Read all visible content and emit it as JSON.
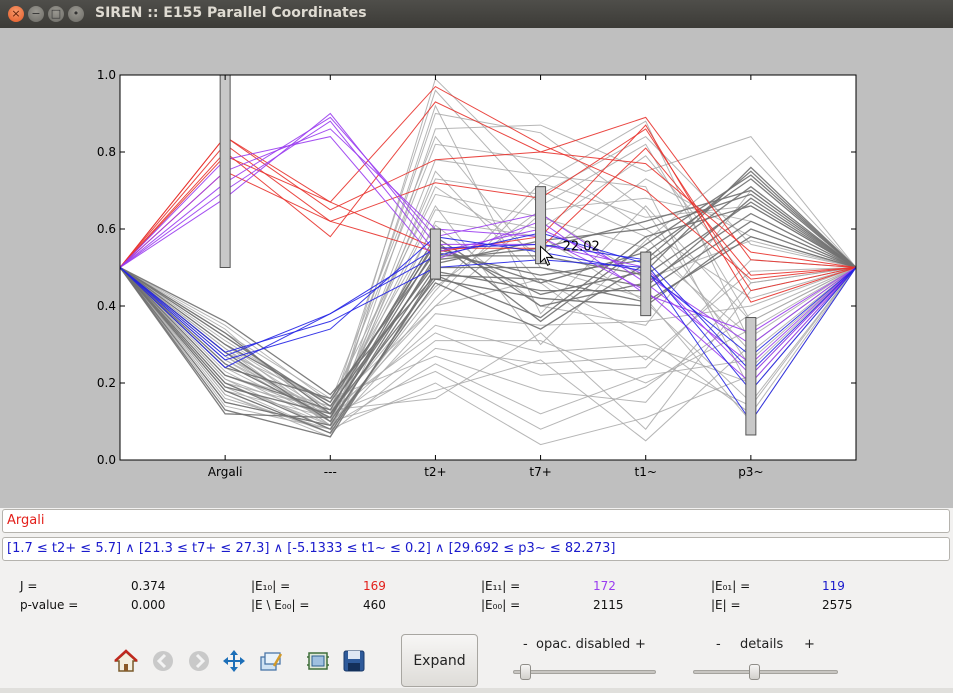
{
  "window": {
    "title": "SIREN :: E155 Parallel Coordinates",
    "close_glyph": "×",
    "min_glyph": "−",
    "max_glyph": "□",
    "extra_glyph": "•"
  },
  "chart_data": {
    "type": "line",
    "title": "",
    "xlabel": "",
    "ylabel": "",
    "ylim": [
      0,
      1.0
    ],
    "yticks": [
      "0.0",
      "0.2",
      "0.4",
      "0.6",
      "0.8",
      "1.0"
    ],
    "categories": [
      "",
      "Argali",
      "---",
      "t2+",
      "t7+",
      "t1~",
      "p3~",
      ""
    ],
    "series_groups": {
      "red": {
        "color": "#e8332e",
        "lines": [
          [
            0.5,
            0.84,
            0.67,
            0.97,
            0.82,
            0.7,
            0.47,
            0.5
          ],
          [
            0.5,
            0.84,
            0.65,
            0.78,
            0.8,
            0.89,
            0.52,
            0.5
          ],
          [
            0.5,
            0.82,
            0.62,
            0.72,
            0.68,
            0.86,
            0.44,
            0.5
          ],
          [
            0.5,
            0.75,
            0.62,
            0.54,
            0.58,
            0.87,
            0.41,
            0.5
          ],
          [
            0.5,
            0.8,
            0.58,
            0.93,
            0.8,
            0.77,
            0.54,
            0.5
          ],
          [
            0.5,
            0.79,
            0.67,
            0.55,
            0.55,
            0.81,
            0.48,
            0.5
          ]
        ]
      },
      "purple": {
        "color": "#9a3cf0",
        "lines": [
          [
            0.5,
            0.72,
            0.89,
            0.58,
            0.64,
            0.46,
            0.25,
            0.5
          ],
          [
            0.5,
            0.7,
            0.88,
            0.54,
            0.6,
            0.48,
            0.3,
            0.5
          ],
          [
            0.5,
            0.75,
            0.86,
            0.6,
            0.58,
            0.44,
            0.2,
            0.5
          ],
          [
            0.5,
            0.78,
            0.84,
            0.52,
            0.62,
            0.43,
            0.33,
            0.5
          ],
          [
            0.5,
            0.68,
            0.9,
            0.56,
            0.56,
            0.5,
            0.22,
            0.5
          ]
        ]
      },
      "blue": {
        "color": "#2323e6",
        "lines": [
          [
            0.5,
            0.24,
            0.38,
            0.55,
            0.56,
            0.52,
            0.23,
            0.5
          ],
          [
            0.5,
            0.28,
            0.36,
            0.5,
            0.52,
            0.5,
            0.1,
            0.5
          ],
          [
            0.5,
            0.26,
            0.34,
            0.58,
            0.54,
            0.49,
            0.27,
            0.5
          ],
          [
            0.5,
            0.27,
            0.38,
            0.53,
            0.59,
            0.51,
            0.18,
            0.5
          ]
        ]
      },
      "dark_gray": {
        "color": "#707070",
        "lines": [
          [
            0.5,
            0.36,
            0.17,
            0.48,
            0.37,
            0.58,
            0.66,
            0.5
          ],
          [
            0.5,
            0.33,
            0.12,
            0.52,
            0.55,
            0.62,
            0.7,
            0.5
          ],
          [
            0.5,
            0.3,
            0.15,
            0.56,
            0.43,
            0.49,
            0.76,
            0.5
          ],
          [
            0.5,
            0.28,
            0.1,
            0.5,
            0.5,
            0.45,
            0.68,
            0.5
          ],
          [
            0.5,
            0.25,
            0.11,
            0.55,
            0.46,
            0.54,
            0.73,
            0.5
          ],
          [
            0.5,
            0.22,
            0.13,
            0.58,
            0.4,
            0.46,
            0.64,
            0.5
          ],
          [
            0.5,
            0.2,
            0.08,
            0.46,
            0.34,
            0.51,
            0.71,
            0.5
          ],
          [
            0.5,
            0.18,
            0.07,
            0.48,
            0.47,
            0.41,
            0.58,
            0.5
          ],
          [
            0.5,
            0.15,
            0.09,
            0.53,
            0.53,
            0.48,
            0.67,
            0.5
          ],
          [
            0.5,
            0.13,
            0.06,
            0.49,
            0.44,
            0.44,
            0.62,
            0.5
          ],
          [
            0.5,
            0.12,
            0.11,
            0.57,
            0.36,
            0.56,
            0.74,
            0.5
          ],
          [
            0.5,
            0.32,
            0.14,
            0.51,
            0.57,
            0.6,
            0.69,
            0.5
          ],
          [
            0.5,
            0.24,
            0.16,
            0.54,
            0.48,
            0.52,
            0.75,
            0.5
          ],
          [
            0.5,
            0.19,
            0.12,
            0.47,
            0.42,
            0.4,
            0.6,
            0.5
          ]
        ]
      },
      "light_gray": {
        "color": "#a9a9a9",
        "lines": [
          [
            0.5,
            0.28,
            0.09,
            0.99,
            0.72,
            0.88,
            0.3,
            0.5
          ],
          [
            0.5,
            0.22,
            0.12,
            0.96,
            0.66,
            0.82,
            0.36,
            0.5
          ],
          [
            0.5,
            0.27,
            0.1,
            0.9,
            0.85,
            0.65,
            0.24,
            0.5
          ],
          [
            0.5,
            0.18,
            0.07,
            0.86,
            0.87,
            0.75,
            0.84,
            0.5
          ],
          [
            0.5,
            0.3,
            0.13,
            0.82,
            0.78,
            0.6,
            0.42,
            0.5
          ],
          [
            0.5,
            0.14,
            0.08,
            0.78,
            0.74,
            0.71,
            0.18,
            0.5
          ],
          [
            0.5,
            0.21,
            0.11,
            0.73,
            0.69,
            0.84,
            0.56,
            0.5
          ],
          [
            0.5,
            0.35,
            0.15,
            0.69,
            0.63,
            0.55,
            0.32,
            0.5
          ],
          [
            0.5,
            0.26,
            0.1,
            0.65,
            0.6,
            0.79,
            0.46,
            0.5
          ],
          [
            0.5,
            0.17,
            0.06,
            0.62,
            0.58,
            0.41,
            0.15,
            0.5
          ],
          [
            0.5,
            0.29,
            0.12,
            0.45,
            0.65,
            0.68,
            0.62,
            0.5
          ],
          [
            0.5,
            0.23,
            0.09,
            0.42,
            0.7,
            0.58,
            0.28,
            0.5
          ],
          [
            0.5,
            0.31,
            0.14,
            0.4,
            0.47,
            0.32,
            0.12,
            0.5
          ],
          [
            0.5,
            0.16,
            0.08,
            0.38,
            0.35,
            0.36,
            0.4,
            0.5
          ],
          [
            0.5,
            0.25,
            0.11,
            0.35,
            0.28,
            0.3,
            0.2,
            0.5
          ],
          [
            0.5,
            0.2,
            0.13,
            0.33,
            0.22,
            0.24,
            0.52,
            0.5
          ],
          [
            0.5,
            0.34,
            0.1,
            0.31,
            0.31,
            0.2,
            0.34,
            0.5
          ],
          [
            0.5,
            0.19,
            0.07,
            0.29,
            0.25,
            0.27,
            0.14,
            0.5
          ],
          [
            0.5,
            0.33,
            0.16,
            0.27,
            0.18,
            0.15,
            0.46,
            0.5
          ],
          [
            0.5,
            0.15,
            0.09,
            0.25,
            0.12,
            0.22,
            0.26,
            0.5
          ],
          [
            0.5,
            0.27,
            0.12,
            0.23,
            0.08,
            0.19,
            0.38,
            0.5
          ],
          [
            0.5,
            0.21,
            0.08,
            0.2,
            0.04,
            0.11,
            0.22,
            0.5
          ],
          [
            0.5,
            0.24,
            0.1,
            0.18,
            0.26,
            0.05,
            0.3,
            0.5
          ],
          [
            0.5,
            0.32,
            0.13,
            0.16,
            0.33,
            0.08,
            0.44,
            0.5
          ],
          [
            0.5,
            0.18,
            0.11,
            0.4,
            0.64,
            0.47,
            0.57,
            0.5
          ],
          [
            0.5,
            0.29,
            0.09,
            0.44,
            0.72,
            0.63,
            0.66,
            0.5
          ],
          [
            0.5,
            0.22,
            0.14,
            0.61,
            0.4,
            0.35,
            0.7,
            0.5
          ],
          [
            0.5,
            0.26,
            0.12,
            0.66,
            0.3,
            0.57,
            0.79,
            0.5
          ],
          [
            0.5,
            0.3,
            0.1,
            0.71,
            0.53,
            0.73,
            0.58,
            0.5
          ],
          [
            0.5,
            0.17,
            0.07,
            0.75,
            0.46,
            0.26,
            0.49,
            0.5
          ],
          [
            0.5,
            0.28,
            0.15,
            0.84,
            0.5,
            0.42,
            0.1,
            0.5
          ],
          [
            0.5,
            0.2,
            0.09,
            0.92,
            0.38,
            0.66,
            0.36,
            0.5
          ]
        ]
      }
    },
    "ranges": [
      {
        "axis": "Argali",
        "low": 0.5,
        "high": 1.0
      },
      {
        "axis": "t2+",
        "low": 0.47,
        "high": 0.6
      },
      {
        "axis": "t7+",
        "low": 0.51,
        "high": 0.71
      },
      {
        "axis": "t1~",
        "low": 0.375,
        "high": 0.54
      },
      {
        "axis": "p3~",
        "low": 0.065,
        "high": 0.37
      }
    ],
    "annotation": {
      "text": "22.02",
      "axis": "t7+",
      "value": 0.555
    }
  },
  "query": {
    "name": "Argali",
    "expression": "[1.7 ≤ t2+ ≤ 5.7] ∧   [21.3 ≤ t7+ ≤ 27.3] ∧   [-5.1333 ≤ t1~ ≤ 0.2] ∧   [29.692 ≤ p3~ ≤ 82.273]"
  },
  "stats": {
    "j_label": "J =",
    "j_value": "0.374",
    "p_label": "p-value =",
    "p_value": "0.000",
    "e10_label": "|E₁₀| =",
    "e10_value": "169",
    "e10_color": "#e3201b",
    "e_minus_e00_label": "|E \\ E₀₀| =",
    "e_minus_e00_value": "460",
    "e11_label": "|E₁₁| =",
    "e11_value": "172",
    "e11_color": "#9a3cf0",
    "e00_label": "|E₀₀| =",
    "e00_value": "2115",
    "e01_label": "|E₀₁| =",
    "e01_value": "119",
    "e01_color": "#1a1acc",
    "e_label": "|E| =",
    "e_value": "2575"
  },
  "toolbar": {
    "icons": [
      "home-icon",
      "back-icon",
      "forward-icon",
      "pan-icon",
      "zoom-icon",
      "configure-icon",
      "save-icon"
    ],
    "expand_label": "Expand"
  },
  "sliders": {
    "opacity": {
      "minus": "-",
      "label": "opac. disabled",
      "plus": "+",
      "level": 0.05
    },
    "details": {
      "minus": "-",
      "label": "details",
      "plus": "+",
      "level": 0.42
    }
  }
}
